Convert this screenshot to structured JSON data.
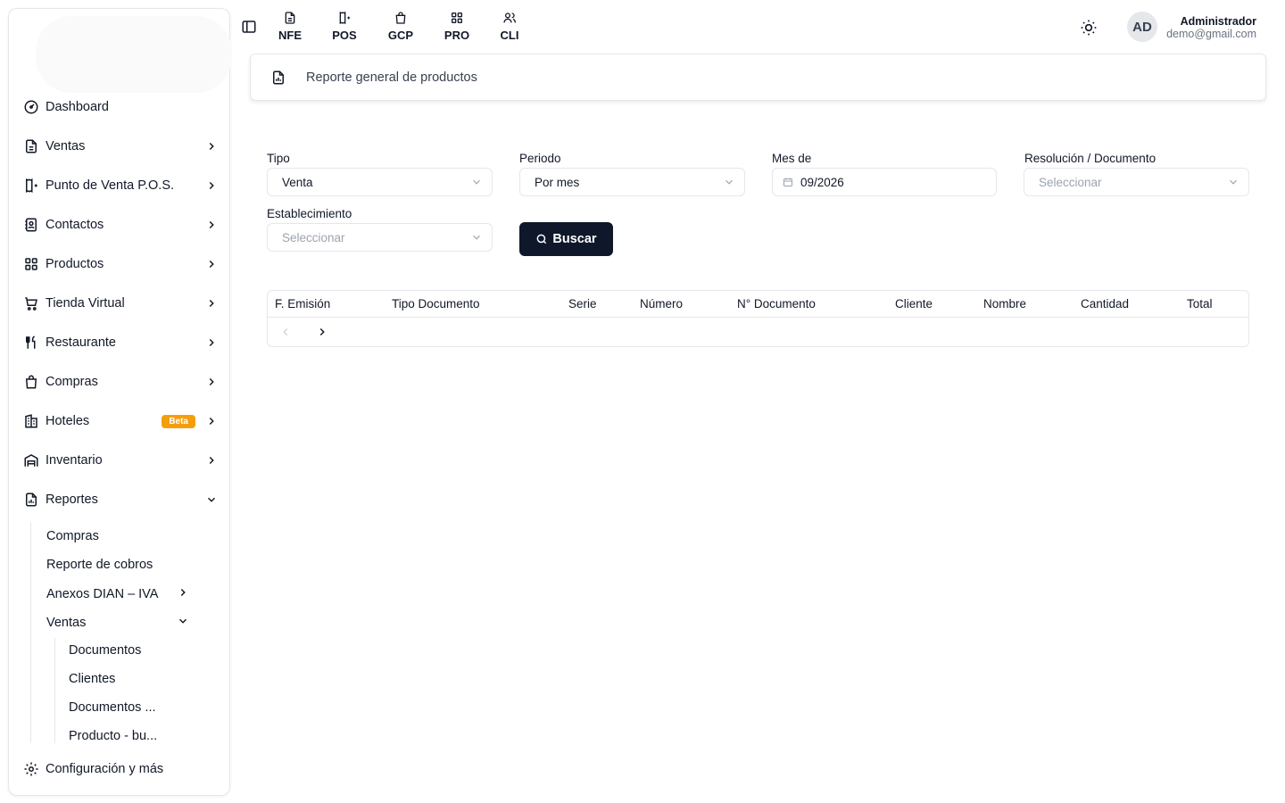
{
  "header": {
    "modules": [
      {
        "label": "NFE",
        "icon": "document-icon"
      },
      {
        "label": "POS",
        "icon": "receipt-icon"
      },
      {
        "label": "GCP",
        "icon": "shopping-bag-icon"
      },
      {
        "label": "PRO",
        "icon": "grid-icon"
      },
      {
        "label": "CLI",
        "icon": "users-icon"
      }
    ],
    "user": {
      "initials": "AD",
      "name": "Administrador",
      "email": "demo@gmail.com"
    }
  },
  "sidebar": {
    "items": [
      {
        "label": "Dashboard",
        "icon": "gauge-icon"
      },
      {
        "label": "Ventas",
        "icon": "document-icon"
      },
      {
        "label": "Punto de Venta P.O.S.",
        "icon": "receipt-icon"
      },
      {
        "label": "Contactos",
        "icon": "contact-book-icon"
      },
      {
        "label": "Productos",
        "icon": "grid-icon"
      },
      {
        "label": "Tienda Virtual",
        "icon": "cart-icon"
      },
      {
        "label": "Restaurante",
        "icon": "utensils-icon"
      },
      {
        "label": "Compras",
        "icon": "shopping-bag-icon"
      },
      {
        "label": "Hoteles",
        "icon": "building-icon",
        "badge": "Beta"
      },
      {
        "label": "Inventario",
        "icon": "warehouse-icon"
      },
      {
        "label": "Reportes",
        "icon": "report-icon"
      }
    ],
    "reportes_sub": [
      {
        "label": "Compras"
      },
      {
        "label": "Reporte de cobros"
      },
      {
        "label": "Anexos DIAN – IVA"
      },
      {
        "label": "Ventas"
      }
    ],
    "ventas_sub": [
      {
        "label": "Documentos"
      },
      {
        "label": "Clientes"
      },
      {
        "label": "Documentos ..."
      },
      {
        "label": "Producto - bu..."
      }
    ],
    "settings": {
      "label": "Configuración y más",
      "icon": "gear-icon"
    }
  },
  "page": {
    "title": "Reporte general de productos"
  },
  "form": {
    "tipo": {
      "label": "Tipo",
      "value": "Venta"
    },
    "periodo": {
      "label": "Periodo",
      "value": "Por mes"
    },
    "mes": {
      "label": "Mes de",
      "value": "09/2026"
    },
    "resolucion": {
      "label": "Resolución / Documento",
      "placeholder": "Seleccionar"
    },
    "establecimiento": {
      "label": "Establecimiento",
      "placeholder": "Seleccionar"
    },
    "buscar_label": "Buscar"
  },
  "table": {
    "columns": [
      "F. Emisión",
      "Tipo Documento",
      "Serie",
      "Número",
      "N° Documento",
      "Cliente",
      "Nombre",
      "Cantidad",
      "Total"
    ],
    "rows": []
  },
  "colors": {
    "primary": "#0f172a",
    "badge": "#f59e0b",
    "border": "#e5e7eb"
  }
}
